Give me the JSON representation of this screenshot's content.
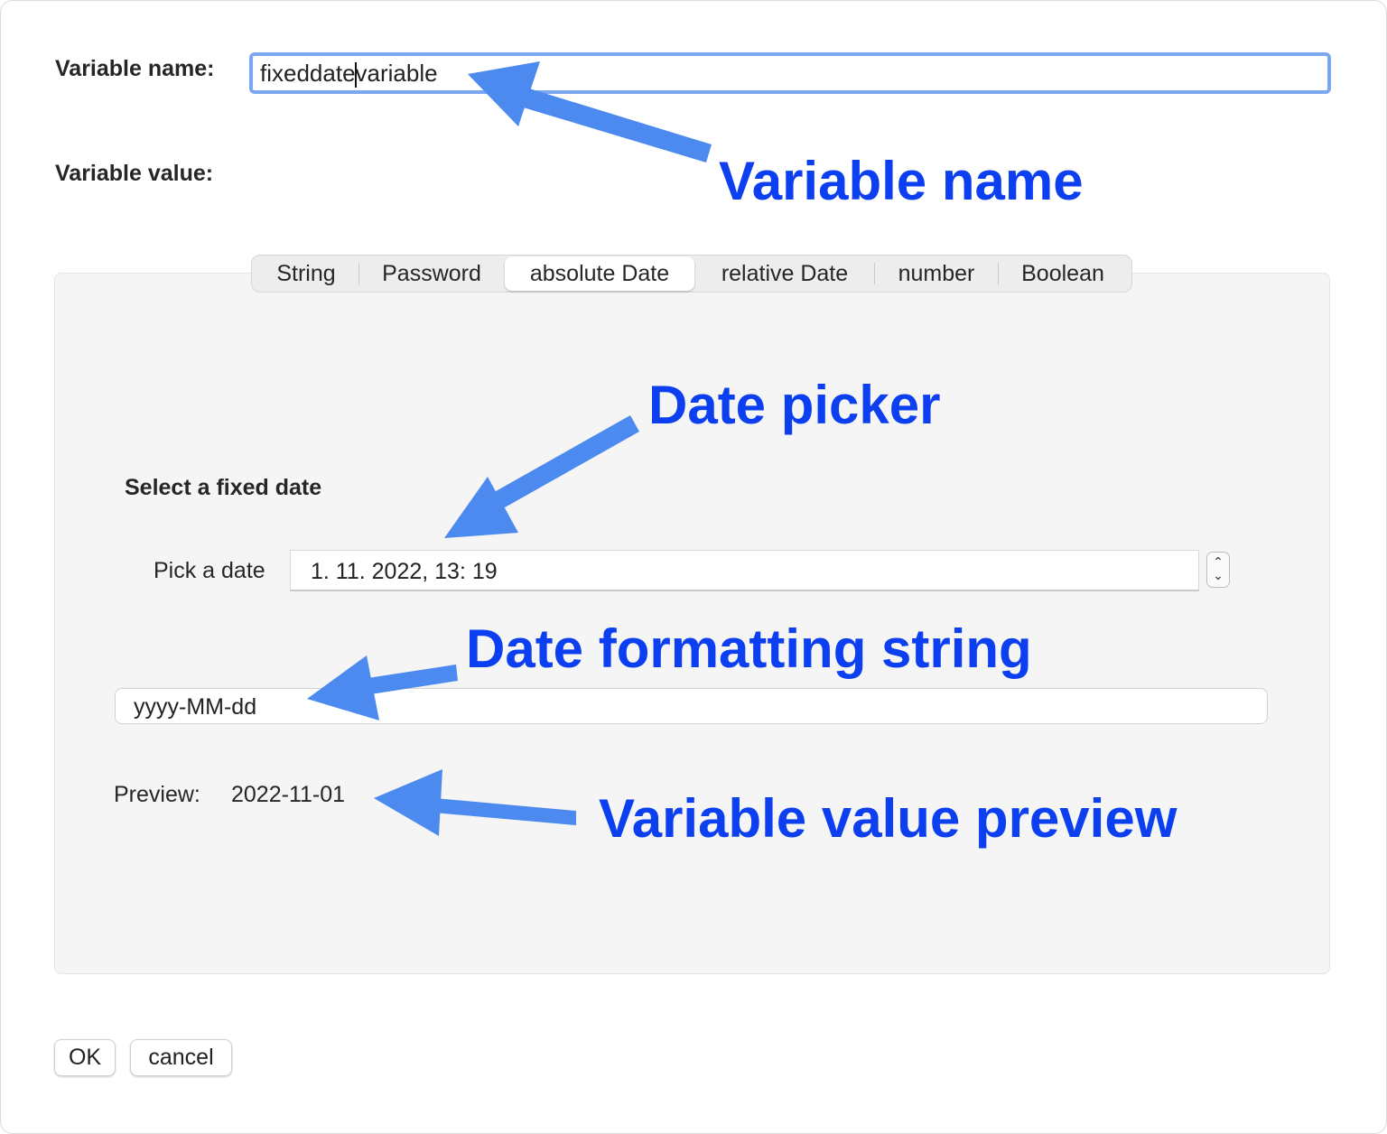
{
  "form": {
    "name_label": "Variable name:",
    "name_value_before_caret": "fixeddate",
    "name_value_after_caret": "variable",
    "value_label": "Variable value:"
  },
  "tabs": [
    {
      "label": "String",
      "active": false
    },
    {
      "label": "Password",
      "active": false
    },
    {
      "label": "absolute Date",
      "active": true
    },
    {
      "label": "relative Date",
      "active": false
    },
    {
      "label": "number",
      "active": false
    },
    {
      "label": "Boolean",
      "active": false
    }
  ],
  "panel": {
    "section_title": "Select a fixed date",
    "pick_label": "Pick a date",
    "date_value": "1. 11. 2022,  13: 19",
    "stepper_up": "⌃",
    "stepper_down": "⌄",
    "format_value": "yyyy-MM-dd",
    "preview_label": "Preview:",
    "preview_value": "2022-11-01"
  },
  "buttons": {
    "ok": "OK",
    "cancel": "cancel"
  },
  "annotations": {
    "variable_name": "Variable name",
    "date_picker": "Date picker",
    "date_formatting": "Date formatting string",
    "value_preview": "Variable value preview"
  },
  "colors": {
    "annotation_text": "#0b3ff0",
    "arrow": "#4d8af0",
    "focus_ring": "#7aa7f0"
  }
}
